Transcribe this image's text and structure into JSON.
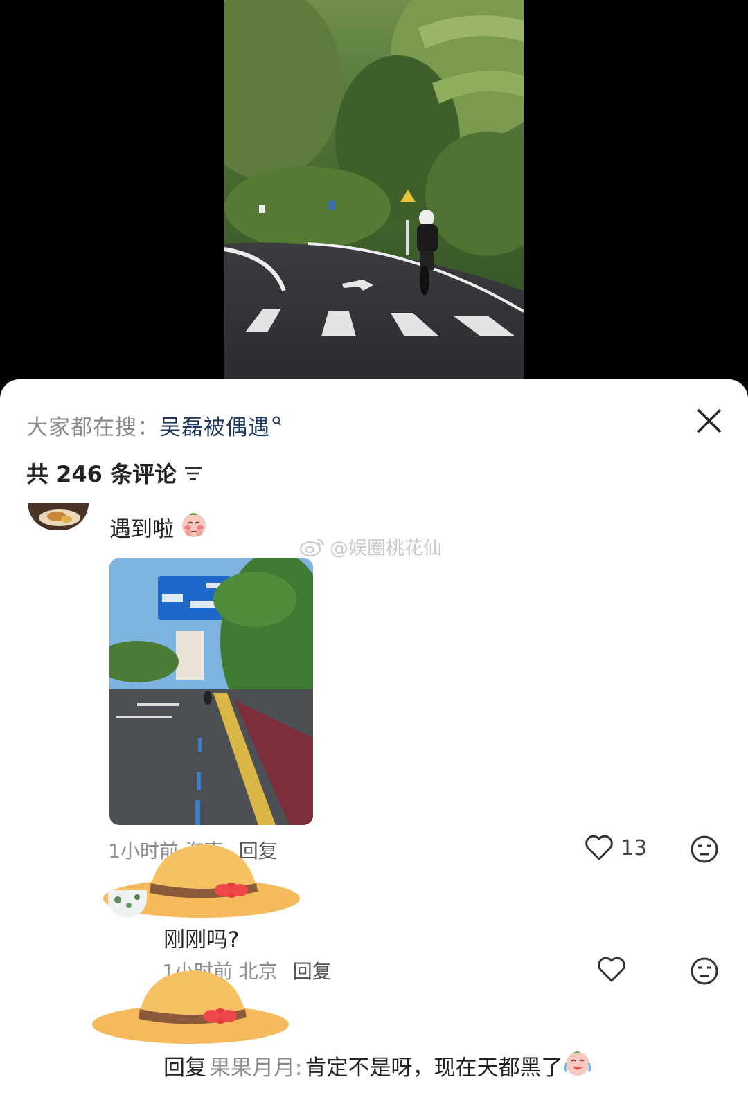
{
  "colors": {
    "sheet_bg": "#ffffff",
    "muted_text": "#8a8a8a",
    "query_text": "#1f3a5c",
    "primary_text": "#222222"
  },
  "trending": {
    "prefix": "大家都在搜：",
    "query": "吴磊被偶遇",
    "query_icon": "search-mini-icon"
  },
  "comments_header": {
    "count_label": "共 246 条评论",
    "sort_icon": "sort-lines-icon"
  },
  "watermark": "@娱圈桃花仙",
  "comments": [
    {
      "text": "遇到啦",
      "emoji": "blush-emoji",
      "time": "1小时前",
      "location": "海南",
      "reply_label": "回复",
      "likes": "13"
    },
    {
      "text": "刚刚吗?",
      "time": "1小时前",
      "location": "北京",
      "reply_label": "回复",
      "likes": ""
    },
    {
      "reply_prefix": "回复",
      "mention": "果果月月:",
      "text": "肯定不是呀，现在天都黑了",
      "emoji": "crying-laugh-emoji"
    }
  ]
}
